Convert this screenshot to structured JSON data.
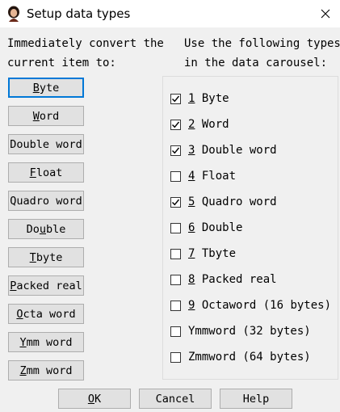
{
  "window": {
    "title": "Setup data types"
  },
  "left_header": "Immediately convert the\ncurrent item to:",
  "right_header": "Use the following types\nin the data carousel:",
  "convert_buttons": [
    {
      "label": "Byte",
      "ul": 0
    },
    {
      "label": "Word",
      "ul": 0
    },
    {
      "label": "Double word",
      "ul": -1
    },
    {
      "label": "Float",
      "ul": 0
    },
    {
      "label": "Quadro word",
      "ul": -1
    },
    {
      "label": "Double",
      "ul": 2
    },
    {
      "label": "Tbyte",
      "ul": 0
    },
    {
      "label": "Packed real",
      "ul": 0
    },
    {
      "label": "Octa word",
      "ul": 0
    },
    {
      "label": "Ymm word",
      "ul": 0
    },
    {
      "label": "Zmm word",
      "ul": 0
    }
  ],
  "carousel_types": [
    {
      "num": "1",
      "label": "Byte",
      "checked": true
    },
    {
      "num": "2",
      "label": "Word",
      "checked": true
    },
    {
      "num": "3",
      "label": "Double word",
      "checked": true
    },
    {
      "num": "4",
      "label": "Float",
      "checked": false
    },
    {
      "num": "5",
      "label": "Quadro word",
      "checked": true
    },
    {
      "num": "6",
      "label": "Double",
      "checked": false
    },
    {
      "num": "7",
      "label": "Tbyte",
      "checked": false
    },
    {
      "num": "8",
      "label": "Packed real",
      "checked": false
    },
    {
      "num": "9",
      "label": "Octaword (16 bytes)",
      "checked": false
    },
    {
      "num": "",
      "label": "Ymmword (32 bytes)",
      "checked": false
    },
    {
      "num": "",
      "label": "Zmmword (64 bytes)",
      "checked": false
    }
  ],
  "footer": {
    "ok": "OK",
    "cancel": "Cancel",
    "help": "Help"
  },
  "colors": {
    "focus": "#0078d7",
    "button_face": "#e1e1e1",
    "background": "#f0f0f0"
  }
}
